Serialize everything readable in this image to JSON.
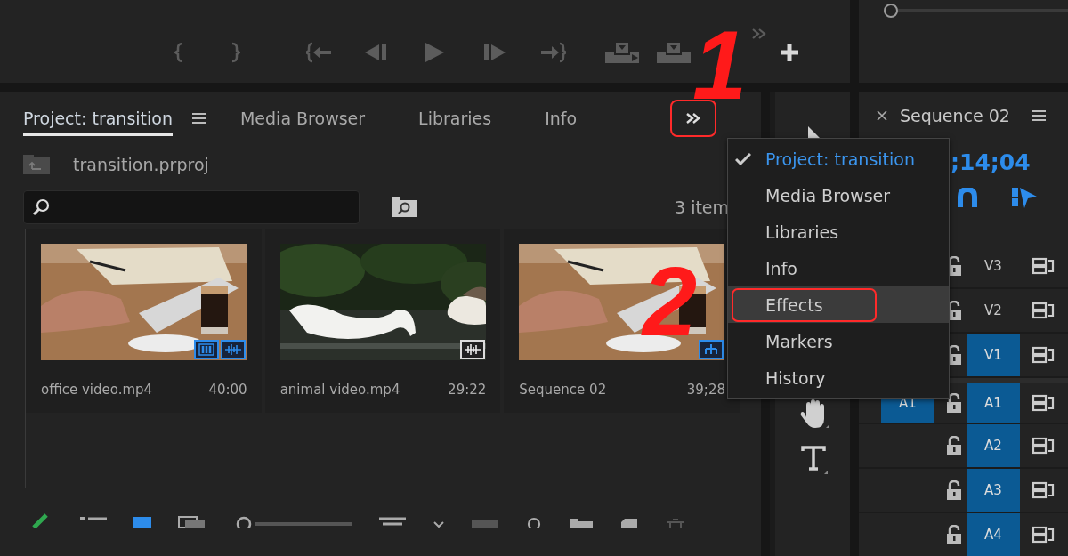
{
  "project_panel": {
    "tabs": [
      {
        "label": "Project: transition",
        "selected": true
      },
      {
        "label": "Media Browser",
        "selected": false
      },
      {
        "label": "Libraries",
        "selected": false
      },
      {
        "label": "Info",
        "selected": false
      }
    ],
    "overflow_button": {
      "annotated": true
    },
    "project_file": "transition.prproj",
    "item_count": "3 item",
    "items": [
      {
        "name": "office video.mp4",
        "duration": "40:00",
        "picture": {
          "kind": "office"
        },
        "badges": [
          {
            "kind": "video"
          },
          {
            "kind": "audio"
          }
        ]
      },
      {
        "name": "animal video.mp4",
        "duration": "29:22",
        "picture": {
          "kind": "animal"
        },
        "badges": [
          {
            "kind": "audio"
          }
        ]
      },
      {
        "name": "Sequence 02",
        "duration": "39;28",
        "picture": {
          "kind": "office"
        },
        "badges": [
          {
            "kind": "sequence"
          }
        ]
      }
    ]
  },
  "overflow_menu": {
    "items": [
      {
        "label": "Project: transition",
        "selected": true,
        "highlighted": false,
        "annotated": false
      },
      {
        "label": "Media Browser",
        "selected": false,
        "highlighted": false,
        "annotated": false
      },
      {
        "label": "Libraries",
        "selected": false,
        "highlighted": false,
        "annotated": false
      },
      {
        "label": "Info",
        "selected": false,
        "highlighted": false,
        "annotated": false
      },
      {
        "label": "Effects",
        "selected": false,
        "highlighted": true,
        "annotated": true
      },
      {
        "label": "Markers",
        "selected": false,
        "highlighted": false,
        "annotated": false
      },
      {
        "label": "History",
        "selected": false,
        "highlighted": false,
        "annotated": false
      }
    ]
  },
  "annotations": [
    {
      "label": "1"
    },
    {
      "label": "2"
    }
  ],
  "timeline": {
    "title": "Sequence 02",
    "timecode": ";14;04",
    "tracks": [
      {
        "name": "V3",
        "targeted": false
      },
      {
        "name": "V2",
        "targeted": false
      },
      {
        "name": "V1",
        "targeted": true
      },
      {
        "name": "A1",
        "targeted": true,
        "source_patch": "A1"
      },
      {
        "name": "A2",
        "targeted": true
      },
      {
        "name": "A3",
        "targeted": true
      },
      {
        "name": "A4",
        "targeted": true
      }
    ]
  }
}
